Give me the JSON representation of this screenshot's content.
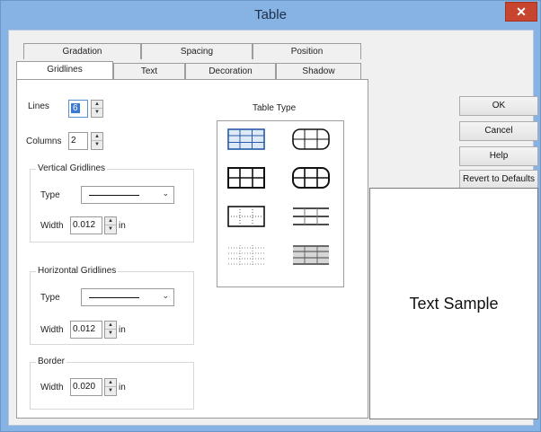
{
  "window": {
    "title": "Table",
    "close_glyph": "✕"
  },
  "tabs": {
    "row_back": [
      "Gradation",
      "Spacing",
      "Position"
    ],
    "row_front": [
      "Gridlines",
      "Text",
      "Decoration",
      "Shadow"
    ],
    "active": "Gridlines"
  },
  "gridlines": {
    "lines_label": "Lines",
    "lines_value": "6",
    "columns_label": "Columns",
    "columns_value": "2",
    "vertical": {
      "title": "Vertical Gridlines",
      "type_label": "Type",
      "width_label": "Width",
      "width_value": "0.012",
      "unit": "in"
    },
    "horizontal": {
      "title": "Horizontal Gridlines",
      "type_label": "Type",
      "width_label": "Width",
      "width_value": "0.012",
      "unit": "in"
    },
    "border": {
      "title": "Border",
      "width_label": "Width",
      "width_value": "0.020",
      "unit": "in"
    },
    "table_type": {
      "title": "Table Type",
      "options": [
        "full-grid",
        "rounded-full-grid",
        "bold-grid",
        "rounded-bold-grid",
        "outline-dotted-grid",
        "horizontal-lines",
        "dotted-grid",
        "shaded-lines"
      ],
      "selected": "full-grid"
    }
  },
  "buttons": {
    "ok": "OK",
    "cancel": "Cancel",
    "help": "Help",
    "revert": "Revert to Defaults"
  },
  "sample": {
    "text": "Text Sample"
  },
  "colors": {
    "title_bar": "#86b3e3",
    "close_button": "#c7452f",
    "selection": "#3b79d6"
  }
}
